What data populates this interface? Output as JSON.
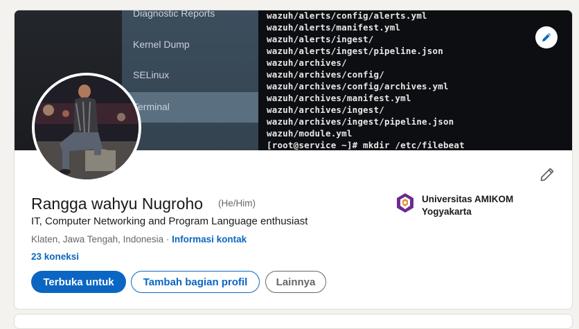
{
  "banner": {
    "menu_items": [
      "Diagnostic Reports",
      "Kernel Dump",
      "SELinux",
      "Terminal"
    ],
    "terminal_lines": [
      "wazuh/alerts/config/alerts.yml",
      "wazuh/alerts/manifest.yml",
      "wazuh/alerts/ingest/",
      "wazuh/alerts/ingest/pipeline.json",
      "wazuh/archives/",
      "wazuh/archives/config/",
      "wazuh/archives/config/archives.yml",
      "wazuh/archives/manifest.yml",
      "wazuh/archives/ingest/",
      "wazuh/archives/ingest/pipeline.json",
      "wazuh/module.yml",
      "[root@service ~]# mkdir /etc/filebeat"
    ],
    "edit_icon": "pencil-icon"
  },
  "profile": {
    "name": "Rangga wahyu Nugroho",
    "pronouns": "(He/Him)",
    "headline": "IT, Computer Networking and Program Language enthusiast",
    "location": "Klaten, Jawa Tengah, Indonesia",
    "separator": " · ",
    "contact_info": "Informasi kontak",
    "connections": "23 koneksi",
    "edit_icon": "pencil-icon"
  },
  "education": {
    "name": "Universitas AMIKOM Yogyakarta"
  },
  "actions": {
    "open_to": "Terbuka untuk",
    "add_section": "Tambah bagian profil",
    "more": "Lainnya"
  },
  "colors": {
    "accent": "#0a66c2",
    "page_bg": "#f4f2ee",
    "text_primary": "#191919",
    "text_secondary": "#666666"
  }
}
